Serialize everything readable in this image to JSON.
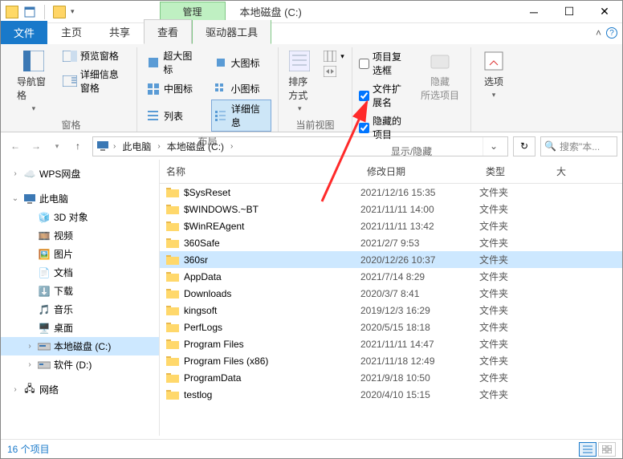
{
  "title_context_tab": "管理",
  "window_title": "本地磁盘 (C:)",
  "tabs": {
    "file": "文件",
    "home": "主页",
    "share": "共享",
    "view": "查看",
    "drive": "驱动器工具"
  },
  "ribbon": {
    "panes": {
      "nav": "导航窗格",
      "preview": "预览窗格",
      "details_pane": "详细信息窗格",
      "group": "窗格"
    },
    "layout": {
      "xl": "超大图标",
      "lg": "大图标",
      "md": "中图标",
      "sm": "小图标",
      "list": "列表",
      "details": "详细信息",
      "group": "布局"
    },
    "current": {
      "sort": "排序方式",
      "group": "当前视图"
    },
    "showhide": {
      "chk_itembox": "项目复选框",
      "chk_ext": "文件扩展名",
      "chk_hidden": "隐藏的项目",
      "hide_btn": "隐藏\n所选项目",
      "group": "显示/隐藏"
    },
    "options": "选项"
  },
  "breadcrumb": {
    "pc": "此电脑",
    "drive": "本地磁盘 (C:)"
  },
  "search_placeholder": "搜索\"本...",
  "tree": {
    "wps": "WPS网盘",
    "pc": "此电脑",
    "threed": "3D 对象",
    "video": "视频",
    "pictures": "图片",
    "docs": "文档",
    "downloads": "下载",
    "music": "音乐",
    "desktop": "桌面",
    "cdrive": "本地磁盘 (C:)",
    "ddrive": "软件 (D:)",
    "network": "网络"
  },
  "columns": {
    "name": "名称",
    "date": "修改日期",
    "type": "类型",
    "size": "大"
  },
  "type_folder": "文件夹",
  "files": [
    {
      "name": "$SysReset",
      "date": "2021/12/16 15:35"
    },
    {
      "name": "$WINDOWS.~BT",
      "date": "2021/11/11 14:00"
    },
    {
      "name": "$WinREAgent",
      "date": "2021/11/11 13:42"
    },
    {
      "name": "360Safe",
      "date": "2021/2/7 9:53"
    },
    {
      "name": "360sr",
      "date": "2020/12/26 10:37",
      "selected": true
    },
    {
      "name": "AppData",
      "date": "2021/7/14 8:29"
    },
    {
      "name": "Downloads",
      "date": "2020/3/7 8:41"
    },
    {
      "name": "kingsoft",
      "date": "2019/12/3 16:29"
    },
    {
      "name": "PerfLogs",
      "date": "2020/5/15 18:18"
    },
    {
      "name": "Program Files",
      "date": "2021/11/11 14:47"
    },
    {
      "name": "Program Files (x86)",
      "date": "2021/11/18 12:49"
    },
    {
      "name": "ProgramData",
      "date": "2021/9/18 10:50"
    },
    {
      "name": "testlog",
      "date": "2020/4/10 15:15"
    }
  ],
  "status_count": "16 个项目"
}
